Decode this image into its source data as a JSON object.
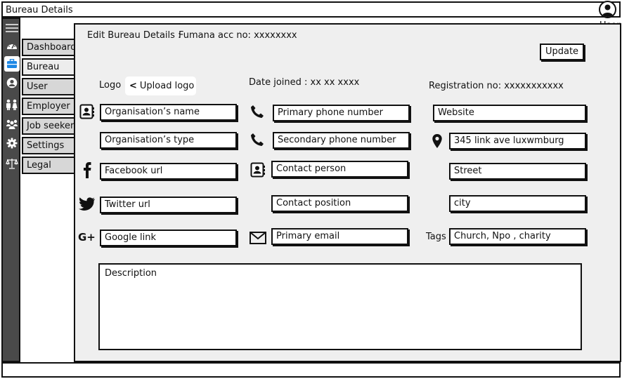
{
  "window": {
    "title": "Bureau Details"
  },
  "user": {
    "label": "User"
  },
  "nav": {
    "items": [
      {
        "label": "Dashboard",
        "icon": "dashboard-icon"
      },
      {
        "label": "Bureau",
        "icon": "briefcase-icon"
      },
      {
        "label": "User",
        "icon": "user-circle-icon"
      },
      {
        "label": "Employer",
        "icon": "people-icon"
      },
      {
        "label": "Job seeker",
        "icon": "group-icon"
      },
      {
        "label": "Settings",
        "icon": "gear-icon"
      },
      {
        "label": "Legal",
        "icon": "scales-icon"
      }
    ],
    "active": "Bureau"
  },
  "header": {
    "edit_label": "Edit Bureau Details :",
    "account_label": "Fumana acc no: xxxxxxxx",
    "update_label": "Update"
  },
  "logo": {
    "label": "Logo",
    "upload_label": "Upload logo"
  },
  "date_joined": "Date joined : xx xx xxxx",
  "registration_no": "Registration no: xxxxxxxxxxx",
  "fields": {
    "org_name": "Organisation’s name",
    "org_type": "Organisation’s type",
    "facebook": "Facebook url",
    "twitter": "Twitter url",
    "google": "Google link",
    "primary_phone": "Primary phone number",
    "secondary_phone": "Secondary phone number",
    "contact_person": "Contact person",
    "contact_position": "Contact position",
    "primary_email": "Primary email",
    "website": "Website",
    "address": "345 link ave luxwmburg",
    "street": "Street",
    "city": "city",
    "tags_label": "Tags",
    "tags": "Church, Npo , charity",
    "description": "Description"
  },
  "colors": {
    "sidebar": "#4a4a4a",
    "panel": "#efefef",
    "tab": "#d7d7d7",
    "active_icon": "#1e88e5"
  }
}
